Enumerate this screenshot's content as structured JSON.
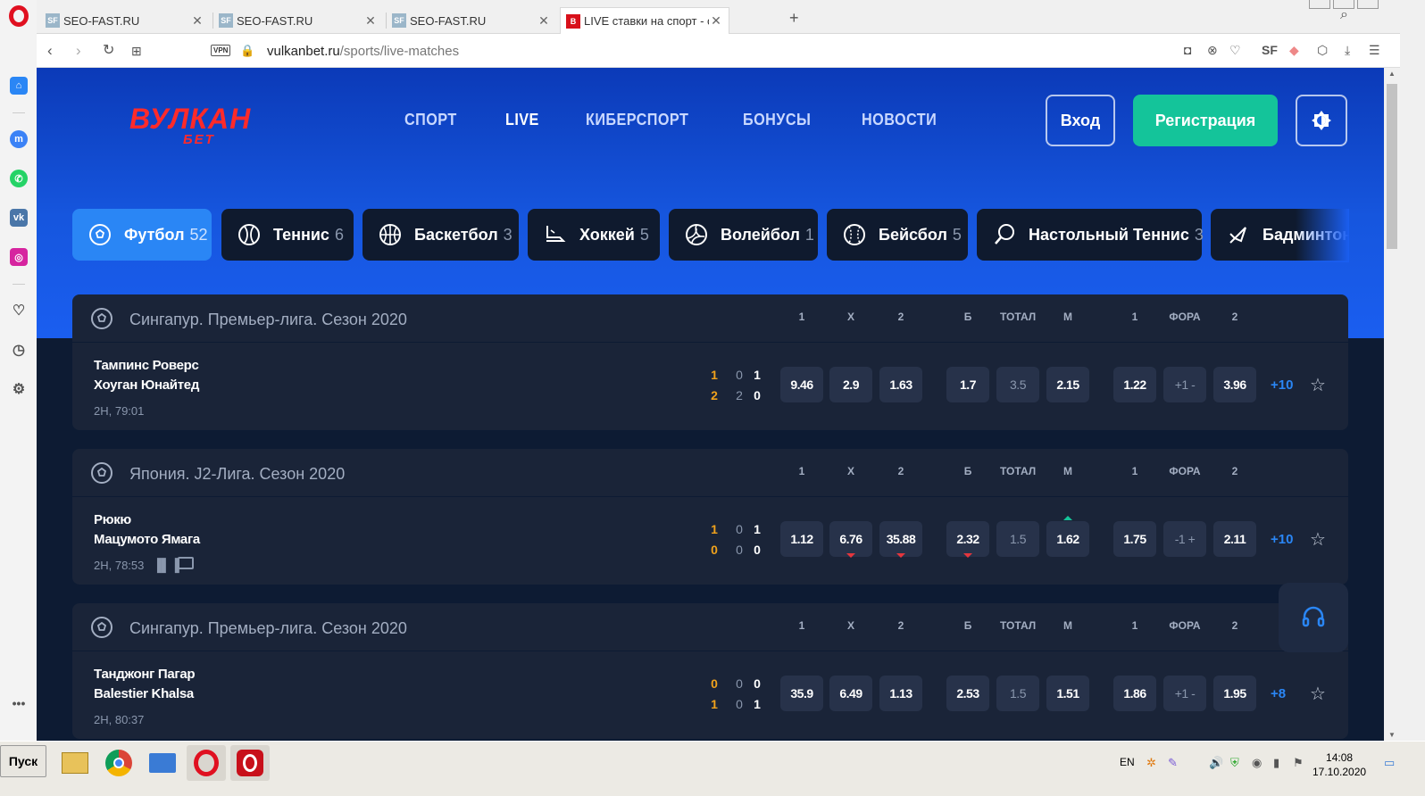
{
  "browser": {
    "tabs": [
      {
        "icon": "SF",
        "title": "SEO-FAST.RU"
      },
      {
        "icon": "SF",
        "title": "SEO-FAST.RU"
      },
      {
        "icon": "SF",
        "title": "SEO-FAST.RU"
      },
      {
        "icon": "B",
        "title": "LIVE ставки на спорт - с"
      }
    ],
    "vpn_label": "VPN",
    "url_domain": "vulkanbet.ru",
    "url_path": "/sports/live-matches"
  },
  "site": {
    "logo_top": "ВУЛКАН",
    "logo_bottom": "БЕТ",
    "nav": [
      "СПОРТ",
      "LIVE",
      "КИБЕРСПОРТ",
      "БОНУСЫ",
      "НОВОСТИ"
    ],
    "login": "Вход",
    "register": "Регистрация",
    "colors": {
      "accent": "#2a86f5",
      "register": "#14c49a",
      "hero": "#1656de",
      "bg": "#0d1b33",
      "score": "#f0a21c"
    }
  },
  "sports": [
    {
      "name": "Футбол",
      "count": "52",
      "icon": "soccer-ball-icon"
    },
    {
      "name": "Теннис",
      "count": "6",
      "icon": "tennis-ball-icon"
    },
    {
      "name": "Баскетбол",
      "count": "3",
      "icon": "basketball-icon"
    },
    {
      "name": "Хоккей",
      "count": "5",
      "icon": "hockey-skate-icon"
    },
    {
      "name": "Волейбол",
      "count": "1",
      "icon": "volleyball-icon"
    },
    {
      "name": "Бейсбол",
      "count": "5",
      "icon": "baseball-icon"
    },
    {
      "name": "Настольный Теннис",
      "count": "3",
      "icon": "table-tennis-icon"
    },
    {
      "name": "Бадминтон",
      "count": "",
      "icon": "shuttlecock-icon"
    }
  ],
  "columns": [
    "1",
    "X",
    "2",
    "Б",
    "ТОТАЛ",
    "М",
    "1",
    "ФОРА",
    "2"
  ],
  "leagues": [
    {
      "name": "Сингапур. Премьер-лига. Сезон 2020",
      "match": {
        "team1": "Тампинс Роверс",
        "team2": "Хоуган Юнайтед",
        "time": "2Н, 79:01",
        "scores": [
          [
            "1",
            "0",
            "1"
          ],
          [
            "2",
            "2",
            "0"
          ]
        ],
        "odds": [
          "9.46",
          "2.9",
          "1.63",
          "1.7",
          "3.5",
          "2.15",
          "1.22",
          "+1 -",
          "3.96"
        ],
        "more": "+10"
      }
    },
    {
      "name": "Япония. J2-Лига. Сезон 2020",
      "match": {
        "team1": "Рюкю",
        "team2": "Мацумото Ямага",
        "time": "2Н, 78:53",
        "scores": [
          [
            "1",
            "0",
            "1"
          ],
          [
            "0",
            "0",
            "0"
          ]
        ],
        "odds": [
          "1.12",
          "6.76",
          "35.88",
          "2.32",
          "1.5",
          "1.62",
          "1.75",
          "-1 +",
          "2.11"
        ],
        "more": "+10"
      }
    },
    {
      "name": "Сингапур. Премьер-лига. Сезон 2020",
      "match": {
        "team1": "Танджонг Пагар",
        "team2": "Balestier Khalsa",
        "time": "2Н, 80:37",
        "scores": [
          [
            "0",
            "0",
            "0"
          ],
          [
            "1",
            "0",
            "1"
          ]
        ],
        "odds": [
          "35.9",
          "6.49",
          "1.13",
          "2.53",
          "1.5",
          "1.51",
          "1.86",
          "+1 -",
          "1.95"
        ],
        "more": "+8"
      }
    }
  ],
  "taskbar": {
    "start": "Пуск",
    "lang": "EN",
    "time": "14:08",
    "date": "17.10.2020"
  }
}
